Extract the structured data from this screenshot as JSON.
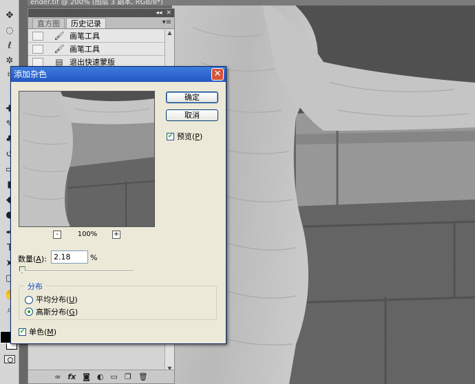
{
  "colors": {
    "dialog_bg": "#ece9d8",
    "title_blue": "#2457c4",
    "check_green": "#21a121",
    "group_title_blue": "#0046d5"
  },
  "window_title": "ender.tif @ 200% (图层 3 副本, RGB/8*)",
  "history_panel": {
    "tabs": [
      {
        "label": "直方图",
        "active": false
      },
      {
        "label": "历史记录",
        "active": true
      }
    ],
    "items": [
      {
        "label": "画笔工具",
        "icon": "brush-icon"
      },
      {
        "label": "画笔工具",
        "icon": "brush-icon"
      },
      {
        "label": "退出快速蒙版",
        "icon": "history-state-icon"
      }
    ],
    "bottom_icons": [
      "link-icon",
      "fx-icon",
      "mask-icon",
      "adjustment-icon",
      "group-icon",
      "new-layer-icon",
      "trash-icon"
    ]
  },
  "dialog": {
    "title": "添加杂色",
    "ok_label": "确定",
    "cancel_label": "取消",
    "preview_label": "预览(",
    "preview_key": "P",
    "preview_label_end": ")",
    "preview_checked": true,
    "zoom_minus": "-",
    "zoom_plus": "+",
    "zoom_level": "100%",
    "amount_label": "数量(",
    "amount_key": "A",
    "amount_label_end": "):",
    "amount_value": "2.18",
    "amount_unit": "%",
    "amount_slider_fraction": 0.01,
    "distribution": {
      "title": "分布",
      "uniform_label": "平均分布(",
      "uniform_key": "U",
      "uniform_end": ")",
      "gaussian_label": "高斯分布(",
      "gaussian_key": "G",
      "gaussian_end": ")",
      "selected": "gaussian"
    },
    "mono_label": "单色(",
    "mono_key": "M",
    "mono_end": ")",
    "mono_checked": true
  }
}
